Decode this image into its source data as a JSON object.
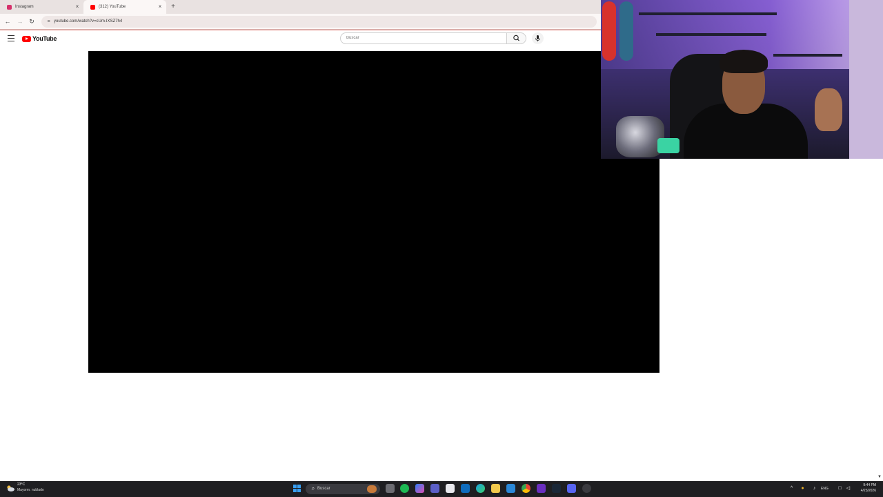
{
  "browser": {
    "tabs": [
      {
        "title": "Instagram",
        "favicon_color": "#d6306b",
        "close": "×"
      },
      {
        "title": "(312) YouTube",
        "favicon_color": "#ff0000",
        "close": "×"
      }
    ],
    "new_tab": "+",
    "url": "youtube.com/watch?v=cUm-IXSZ7h4",
    "nav": {
      "back": "←",
      "forward": "→",
      "reload": "↻"
    }
  },
  "youtube": {
    "logo_text": "YouTube",
    "search_placeholder": "Buscar"
  },
  "taskbar": {
    "weather_temp": "23°C",
    "weather_desc": "Mayorm. nublado",
    "search_label": "Buscar",
    "language": "ENG",
    "time": "9:44 PM",
    "date": "4/23/2026"
  }
}
